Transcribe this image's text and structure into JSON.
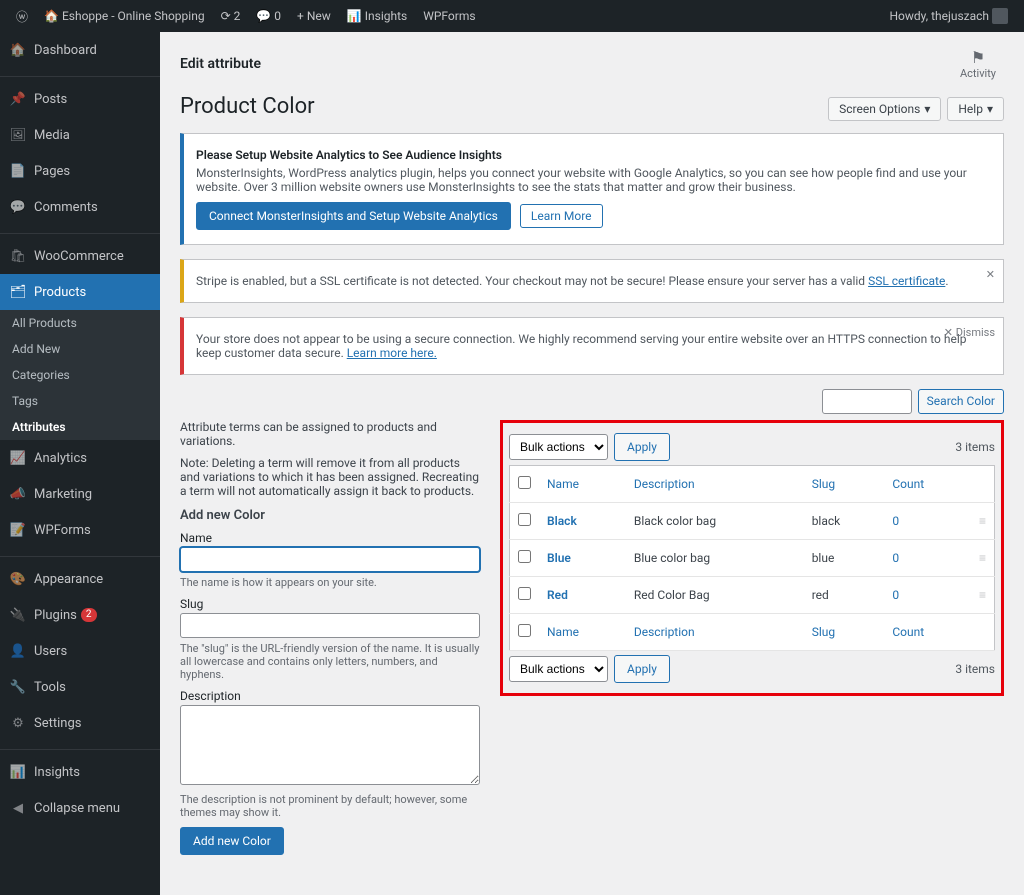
{
  "adminbar": {
    "site": "Eshoppe - Online Shopping",
    "updates": "2",
    "comments": "0",
    "new": "New",
    "insights": "Insights",
    "wpforms": "WPForms",
    "howdy": "Howdy, thejuszach"
  },
  "sidebar": {
    "dashboard": "Dashboard",
    "posts": "Posts",
    "media": "Media",
    "pages": "Pages",
    "comments": "Comments",
    "woocommerce": "WooCommerce",
    "products": "Products",
    "analytics": "Analytics",
    "marketing": "Marketing",
    "wpforms": "WPForms",
    "appearance": "Appearance",
    "plugins": "Plugins",
    "plugins_badge": "2",
    "users": "Users",
    "tools": "Tools",
    "settings": "Settings",
    "insights": "Insights",
    "collapse": "Collapse menu",
    "submenu": {
      "all": "All Products",
      "add_new": "Add New",
      "categories": "Categories",
      "tags": "Tags",
      "attributes": "Attributes"
    }
  },
  "header": {
    "edit_attribute": "Edit attribute",
    "activity": "Activity",
    "page_title": "Product Color",
    "screen_options": "Screen Options",
    "help": "Help"
  },
  "notices": {
    "mi_title": "Please Setup Website Analytics to See Audience Insights",
    "mi_body": "MonsterInsights, WordPress analytics plugin, helps you connect your website with Google Analytics, so you can see how people find and use your website. Over 3 million website owners use MonsterInsights to see the stats that matter and grow their business.",
    "mi_connect": "Connect MonsterInsights and Setup Website Analytics",
    "mi_learn": "Learn More",
    "stripe": "Stripe is enabled, but a SSL certificate is not detected. Your checkout may not be secure! Please ensure your server has a valid ",
    "stripe_link": "SSL certificate",
    "https": "Your store does not appear to be using a secure connection. We highly recommend serving your entire website over an HTTPS connection to help keep customer data secure. ",
    "https_link": "Learn more here.",
    "dismiss": "Dismiss"
  },
  "left": {
    "intro1": "Attribute terms can be assigned to products and variations.",
    "intro2": "Note: Deleting a term will remove it from all products and variations to which it has been assigned. Recreating a term will not automatically assign it back to products.",
    "heading": "Add new Color",
    "name_label": "Name",
    "name_help": "The name is how it appears on your site.",
    "slug_label": "Slug",
    "slug_help": "The \"slug\" is the URL-friendly version of the name. It is usually all lowercase and contains only letters, numbers, and hyphens.",
    "desc_label": "Description",
    "desc_help": "The description is not prominent by default; however, some themes may show it.",
    "submit": "Add new Color"
  },
  "search": {
    "placeholder": "",
    "button": "Search Color"
  },
  "table": {
    "bulk": "Bulk actions",
    "apply": "Apply",
    "items_count": "3 items",
    "cols": {
      "name": "Name",
      "description": "Description",
      "slug": "Slug",
      "count": "Count"
    },
    "rows": [
      {
        "name": "Black",
        "description": "Black color bag",
        "slug": "black",
        "count": "0"
      },
      {
        "name": "Blue",
        "description": "Blue color bag",
        "slug": "blue",
        "count": "0"
      },
      {
        "name": "Red",
        "description": "Red Color Bag",
        "slug": "red",
        "count": "0"
      }
    ]
  }
}
